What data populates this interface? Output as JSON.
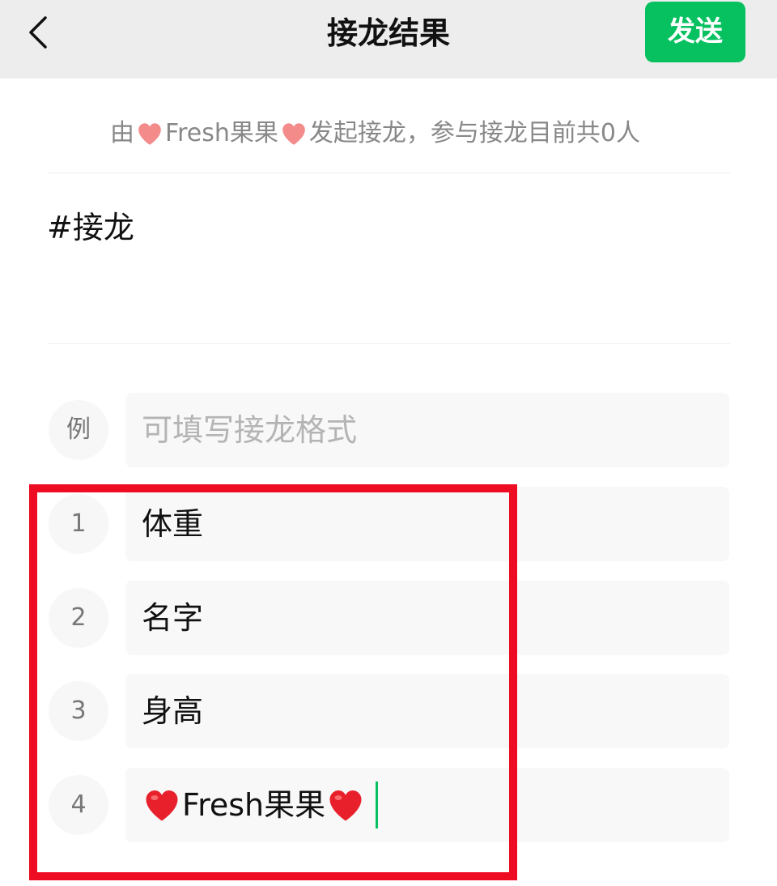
{
  "navbar": {
    "title": "接龙结果",
    "send_label": "发送",
    "back_icon": "chevron-left-icon"
  },
  "info": {
    "prefix": "由",
    "name": "Fresh果果",
    "suffix": "发起接龙，参与接龙目前共0人",
    "heart_icon": "heart-icon"
  },
  "topic": {
    "text": "#接龙"
  },
  "example": {
    "badge": "例",
    "placeholder": "可填写接龙格式"
  },
  "entries": [
    {
      "index": "1",
      "text": "体重"
    },
    {
      "index": "2",
      "text": "名字"
    },
    {
      "index": "3",
      "text": "身高"
    },
    {
      "index": "4",
      "text": "Fresh果果"
    }
  ],
  "colors": {
    "accent": "#07c160",
    "highlight": "#ee0c23",
    "heart": "#e8202c",
    "heart_light": "#f48b8b"
  }
}
